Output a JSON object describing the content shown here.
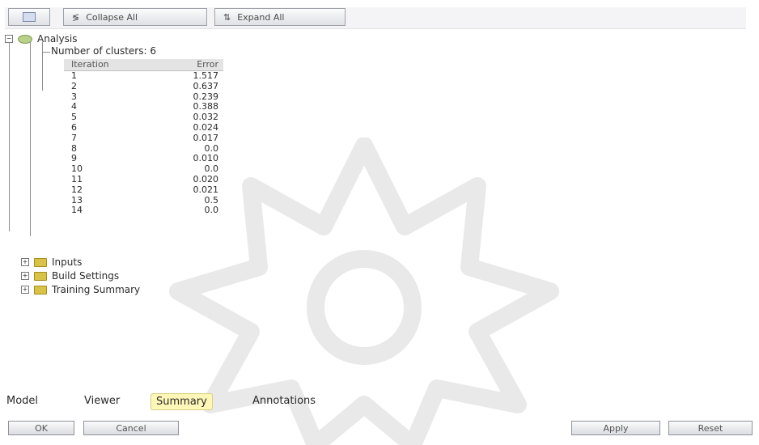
{
  "toolbar": {
    "collapse_all_label": "Collapse All",
    "expand_all_label": "Expand All"
  },
  "tree": {
    "root_label": "Analysis",
    "clusters_label": "Number of clusters: 6",
    "table_headers": [
      "Iteration",
      "Error"
    ],
    "rows": [
      {
        "iteration": "1",
        "value": "1.517"
      },
      {
        "iteration": "2",
        "value": "0.637"
      },
      {
        "iteration": "3",
        "value": "0.239"
      },
      {
        "iteration": "4",
        "value": "0.388"
      },
      {
        "iteration": "5",
        "value": "0.032"
      },
      {
        "iteration": "6",
        "value": "0.024"
      },
      {
        "iteration": "7",
        "value": "0.017"
      },
      {
        "iteration": "8",
        "value": "0.0"
      },
      {
        "iteration": "9",
        "value": "0.010"
      },
      {
        "iteration": "10",
        "value": "0.0"
      },
      {
        "iteration": "11",
        "value": "0.020"
      },
      {
        "iteration": "12",
        "value": "0.021"
      },
      {
        "iteration": "13",
        "value": "0.5"
      },
      {
        "iteration": "14",
        "value": "0.0"
      }
    ],
    "folders": [
      "Inputs",
      "Build Settings",
      "Training Summary"
    ]
  },
  "tabs": [
    "Model",
    "Viewer",
    "Summary",
    "Annotations"
  ],
  "active_tab": "Summary",
  "footer": {
    "ok": "OK",
    "cancel": "Cancel",
    "apply": "Apply",
    "reset": "Reset"
  },
  "colors": {
    "active_tab_bg": "#fff7b8",
    "folder_yellow": "#d9c24a"
  }
}
